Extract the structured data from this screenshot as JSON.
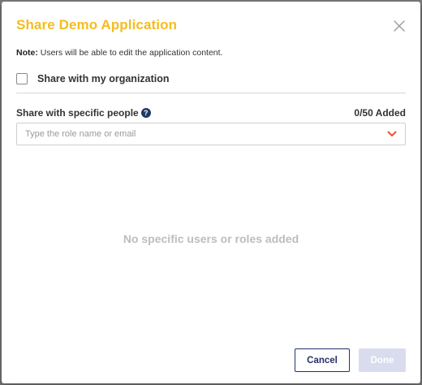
{
  "dialog": {
    "title": "Share Demo Application",
    "title_color": "#f3bd1e",
    "close_icon": "close-icon"
  },
  "note": {
    "prefix": "Note:",
    "text": " Users will be able to edit the application content."
  },
  "organization": {
    "label": "Share with my organization",
    "checked": false
  },
  "people": {
    "label": "Share with specific people",
    "help_icon": "help-icon",
    "help_glyph": "?",
    "count_text": "0/50 Added"
  },
  "search": {
    "placeholder": "Type the role name or email",
    "dropdown_icon": "chevron-down-icon",
    "dropdown_color": "#e8542a"
  },
  "empty_state": {
    "message": "No specific users or roles added"
  },
  "actions": {
    "cancel_label": "Cancel",
    "done_label": "Done",
    "done_enabled": false,
    "primary_color": "#25306b"
  }
}
